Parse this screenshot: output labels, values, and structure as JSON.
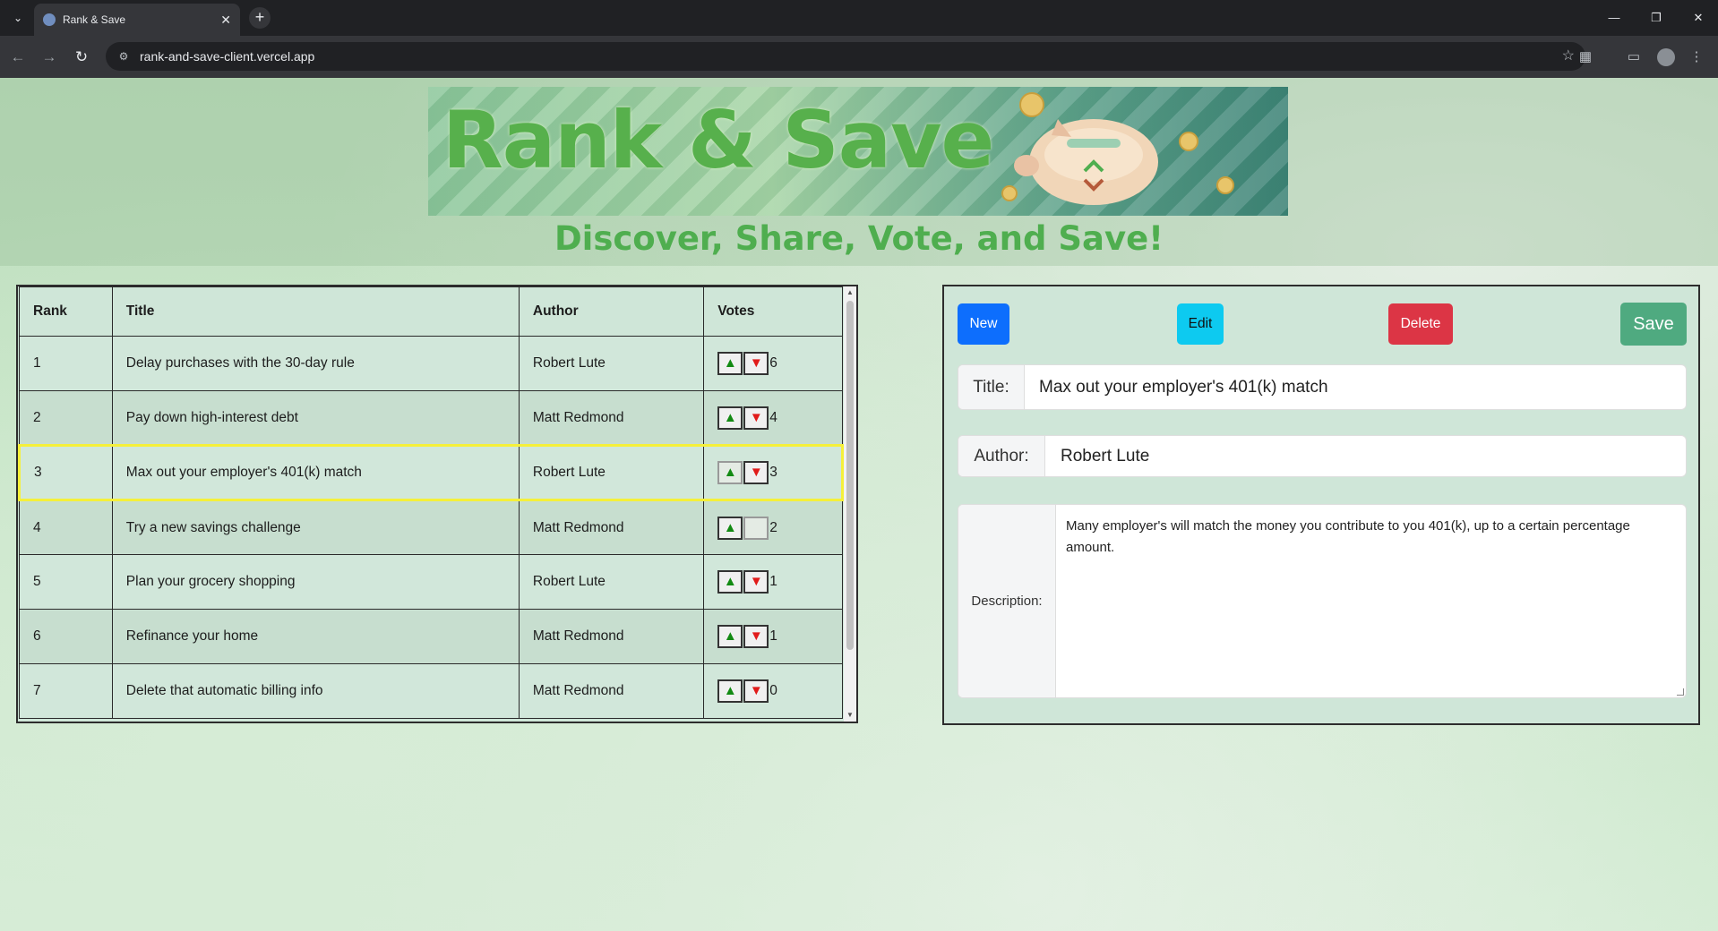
{
  "browser": {
    "tab_title": "Rank & Save",
    "url": "rank-and-save-client.vercel.app"
  },
  "header": {
    "banner_text": "Rank & Save",
    "tagline": "Discover, Share, Vote, and Save!"
  },
  "table": {
    "headers": [
      "Rank",
      "Title",
      "Author",
      "Votes"
    ],
    "rows": [
      {
        "rank": "1",
        "title": "Delay purchases with the 30-day rule",
        "author": "Robert Lute",
        "votes": "6"
      },
      {
        "rank": "2",
        "title": "Pay down high-interest debt",
        "author": "Matt Redmond",
        "votes": "4"
      },
      {
        "rank": "3",
        "title": "Max out your employer's 401(k) match",
        "author": "Robert Lute",
        "votes": "3"
      },
      {
        "rank": "4",
        "title": "Try a new savings challenge",
        "author": "Matt Redmond",
        "votes": "2"
      },
      {
        "rank": "5",
        "title": "Plan your grocery shopping",
        "author": "Robert Lute",
        "votes": "1"
      },
      {
        "rank": "6",
        "title": "Refinance your home",
        "author": "Matt Redmond",
        "votes": "1"
      },
      {
        "rank": "7",
        "title": "Delete that automatic billing info",
        "author": "Matt Redmond",
        "votes": "0"
      }
    ],
    "selected_rank": "3",
    "upvote_icon": "triangle-up-icon",
    "downvote_icon": "triangle-down-icon",
    "colors": {
      "up": "#138a13",
      "down": "#e11a1a",
      "selected_outline": "#f5f03a"
    }
  },
  "form": {
    "buttons": {
      "new": "New",
      "edit": "Edit",
      "delete": "Delete",
      "save": "Save"
    },
    "button_colors": {
      "new": "#0d6efd",
      "edit": "#0dcaf0",
      "delete": "#dc3545",
      "save": "#4faa80"
    },
    "title_label": "Title:",
    "title_value": "Max out your employer's 401(k) match",
    "author_label": "Author:",
    "author_value": "Robert Lute",
    "description_label": "Description:",
    "description_value": "Many employer's will match the money you contribute to you 401(k), up to a certain percentage amount."
  }
}
